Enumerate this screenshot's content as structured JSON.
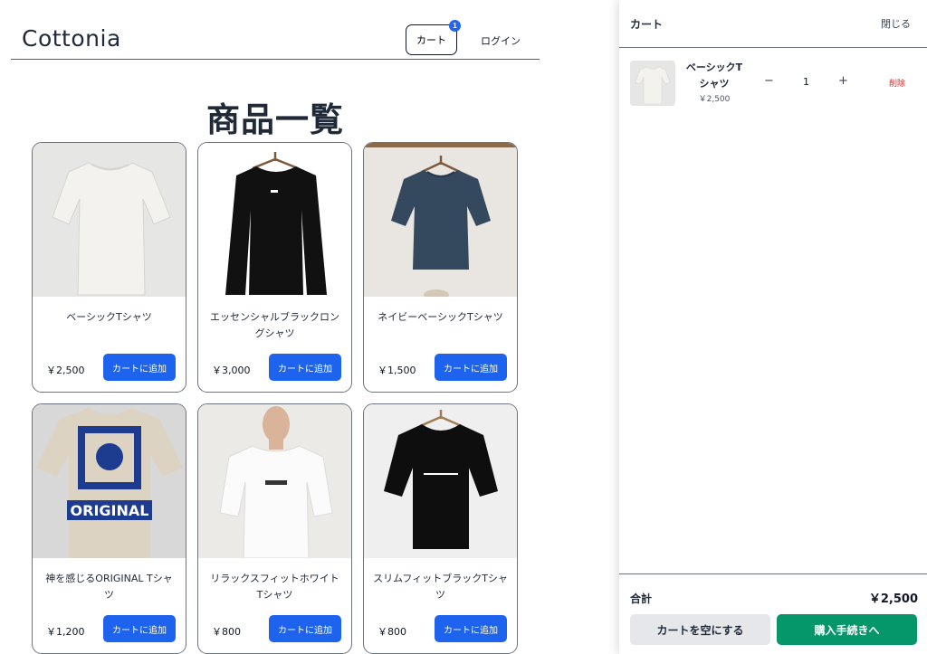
{
  "header": {
    "logo": "Cottonia",
    "cart_label": "カート",
    "cart_count": "1",
    "login_label": "ログイン"
  },
  "page_title": "商品一覧",
  "products": [
    {
      "name": "ベーシックTシャツ",
      "price": "￥2,500",
      "button": "カートに追加",
      "image_icon": "white-tshirt-image",
      "bg": "#e6e6e4",
      "shirt": "#f3f2ee"
    },
    {
      "name": "エッセンシャルブラックロングシャツ",
      "price": "￥3,000",
      "button": "カートに追加",
      "image_icon": "black-longsleeve-image",
      "bg": "#ffffff",
      "shirt": "#111111"
    },
    {
      "name": "ネイビーベーシックTシャツ",
      "price": "￥1,500",
      "button": "カートに追加",
      "image_icon": "navy-tshirt-image",
      "bg": "#e9e6e1",
      "shirt": "#34495e"
    },
    {
      "name": "神を感じるORIGINAL Tシャツ",
      "price": "￥1,200",
      "button": "カートに追加",
      "image_icon": "original-print-tshirt-image",
      "bg": "#d8d8d8",
      "shirt": "#ddd3c3"
    },
    {
      "name": "リラックスフィットホワイトTシャツ",
      "price": "￥800",
      "button": "カートに追加",
      "image_icon": "white-relaxfit-tshirt-image",
      "bg": "#eceae7",
      "shirt": "#fbfbfb"
    },
    {
      "name": "スリムフィットブラックTシャツ",
      "price": "￥800",
      "button": "カートに追加",
      "image_icon": "black-slimfit-tshirt-image",
      "bg": "#efefef",
      "shirt": "#0e0e0e"
    }
  ],
  "cart": {
    "title": "カート",
    "close_label": "閉じる",
    "items": [
      {
        "name": "ベーシックTシャツ",
        "price": "￥2,500",
        "qty": "1",
        "minus": "−",
        "plus": "+",
        "delete": "削除"
      }
    ],
    "total_label": "合計",
    "total_value": "￥2,500",
    "clear_label": "カートを空にする",
    "checkout_label": "購入手続きへ"
  },
  "colors": {
    "primary": "#1d63ed",
    "checkout": "#059669",
    "delete": "#dc2626",
    "badge": "#2563eb"
  }
}
